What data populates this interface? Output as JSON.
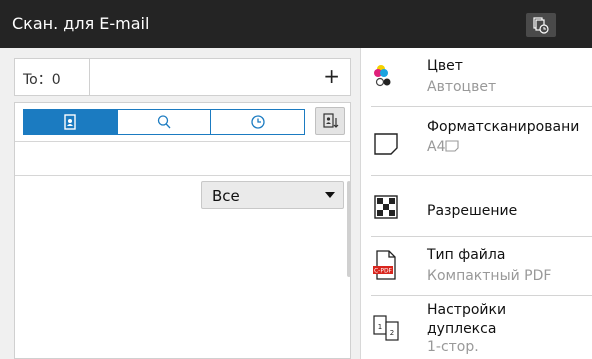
{
  "title": "Скан. для E-mail",
  "to": {
    "label": "To：0",
    "add": "+"
  },
  "tabs": [
    {
      "name": "address-book",
      "active": true
    },
    {
      "name": "search",
      "active": false
    },
    {
      "name": "history",
      "active": false
    }
  ],
  "filter": {
    "selected": "Все"
  },
  "settings": [
    {
      "title": "Цвет",
      "value": "Автоцвет",
      "icon": "color-icon"
    },
    {
      "title": "Форматсканировани",
      "value": "A4",
      "icon": "paper-size-icon"
    },
    {
      "title": "Разрешение",
      "value": "",
      "icon": "resolution-icon"
    },
    {
      "title": "Тип файла",
      "value": "Компактный PDF",
      "icon": "file-type-icon",
      "icon_text": "C-PDF"
    },
    {
      "title_line1": "Настройки",
      "title_line2": "дуплекса",
      "value": "1-стор.",
      "icon": "duplex-icon",
      "icon_text_1": "1",
      "icon_text_2": "2"
    }
  ],
  "colors": {
    "accent": "#1b7bc1",
    "titlebar": "#242424"
  }
}
